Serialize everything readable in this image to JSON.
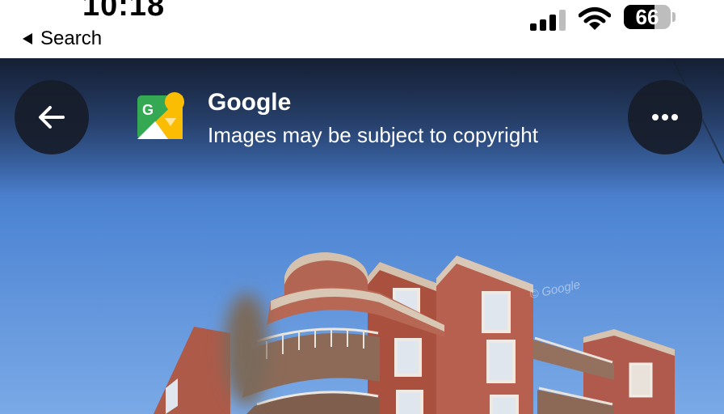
{
  "status_bar": {
    "time": "10:18",
    "back_label": "Search",
    "battery_percent": "66",
    "battery_level": 0.66,
    "icons": [
      "signal-icon",
      "wifi-icon",
      "battery-icon"
    ]
  },
  "viewer": {
    "source_name": "Google",
    "notice": "Images may be subject to copyright",
    "back_icon": "arrow-left-icon",
    "more_icon": "more-horizontal-icon",
    "logo_icon": "google-street-view-logo",
    "watermark": "© Google"
  },
  "colors": {
    "sky_top": "#3b6fc0",
    "sky_bottom": "#6d9de0",
    "brick": "#b4584a",
    "trim": "#d9c8b8",
    "button_bg": "#161c28"
  }
}
